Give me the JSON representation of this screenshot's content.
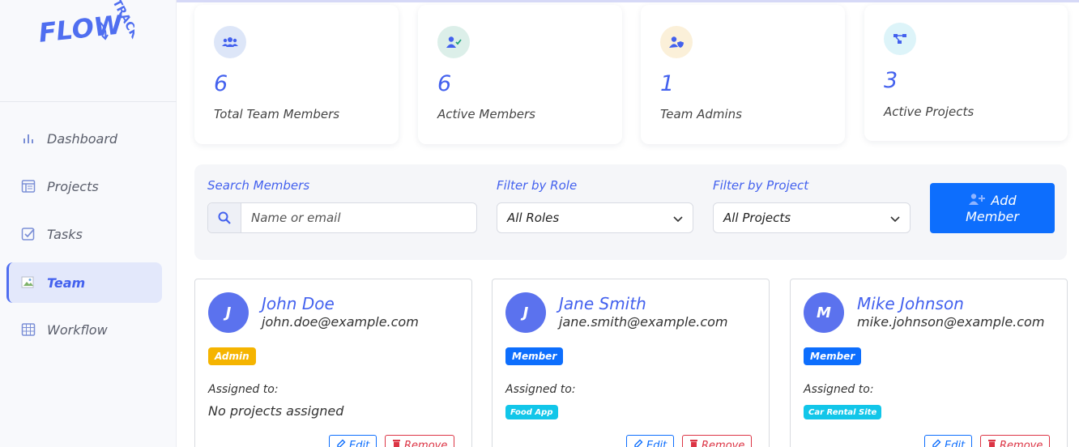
{
  "app": {
    "logo_text": "FLOW",
    "logo_sub": "TRACK"
  },
  "sidebar": {
    "items": [
      {
        "label": "Dashboard",
        "icon": "bar-chart-icon"
      },
      {
        "label": "Projects",
        "icon": "table-icon"
      },
      {
        "label": "Tasks",
        "icon": "checkbox-icon"
      },
      {
        "label": "Team",
        "icon": "broken-image-icon",
        "active": true
      },
      {
        "label": "Workflow",
        "icon": "grid-icon"
      }
    ]
  },
  "stats": [
    {
      "value": "6",
      "label": "Total Team Members",
      "icon": "users-icon"
    },
    {
      "value": "6",
      "label": "Active Members",
      "icon": "user-check-icon"
    },
    {
      "value": "1",
      "label": "Team Admins",
      "icon": "user-shield-icon"
    },
    {
      "value": "3",
      "label": "Active Projects",
      "icon": "project-diagram-icon"
    }
  ],
  "filters": {
    "search_label": "Search Members",
    "search_placeholder": "Name or email",
    "role_label": "Filter by Role",
    "role_value": "All Roles",
    "project_label": "Filter by Project",
    "project_value": "All Projects",
    "add_label_1": "Add",
    "add_label_2": "Member"
  },
  "members": [
    {
      "initial": "J",
      "name": "John Doe",
      "email": "john.doe@example.com",
      "role": "Admin",
      "assigned_label": "Assigned to:",
      "projects_text": "No projects assigned",
      "edit": "Edit",
      "remove": "Remove"
    },
    {
      "initial": "J",
      "name": "Jane Smith",
      "email": "jane.smith@example.com",
      "role": "Member",
      "assigned_label": "Assigned to:",
      "project": "Food App",
      "edit": "Edit",
      "remove": "Remove"
    },
    {
      "initial": "M",
      "name": "Mike Johnson",
      "email": "mike.johnson@example.com",
      "role": "Member",
      "assigned_label": "Assigned to:",
      "project": "Car Rental Site",
      "edit": "Edit",
      "remove": "Remove"
    }
  ],
  "colors": {
    "accent": "#4361ee",
    "primary_button": "#0d6efd",
    "admin_badge": "#f5b400",
    "project_badge": "#12c6e9",
    "danger": "#dc3545"
  }
}
